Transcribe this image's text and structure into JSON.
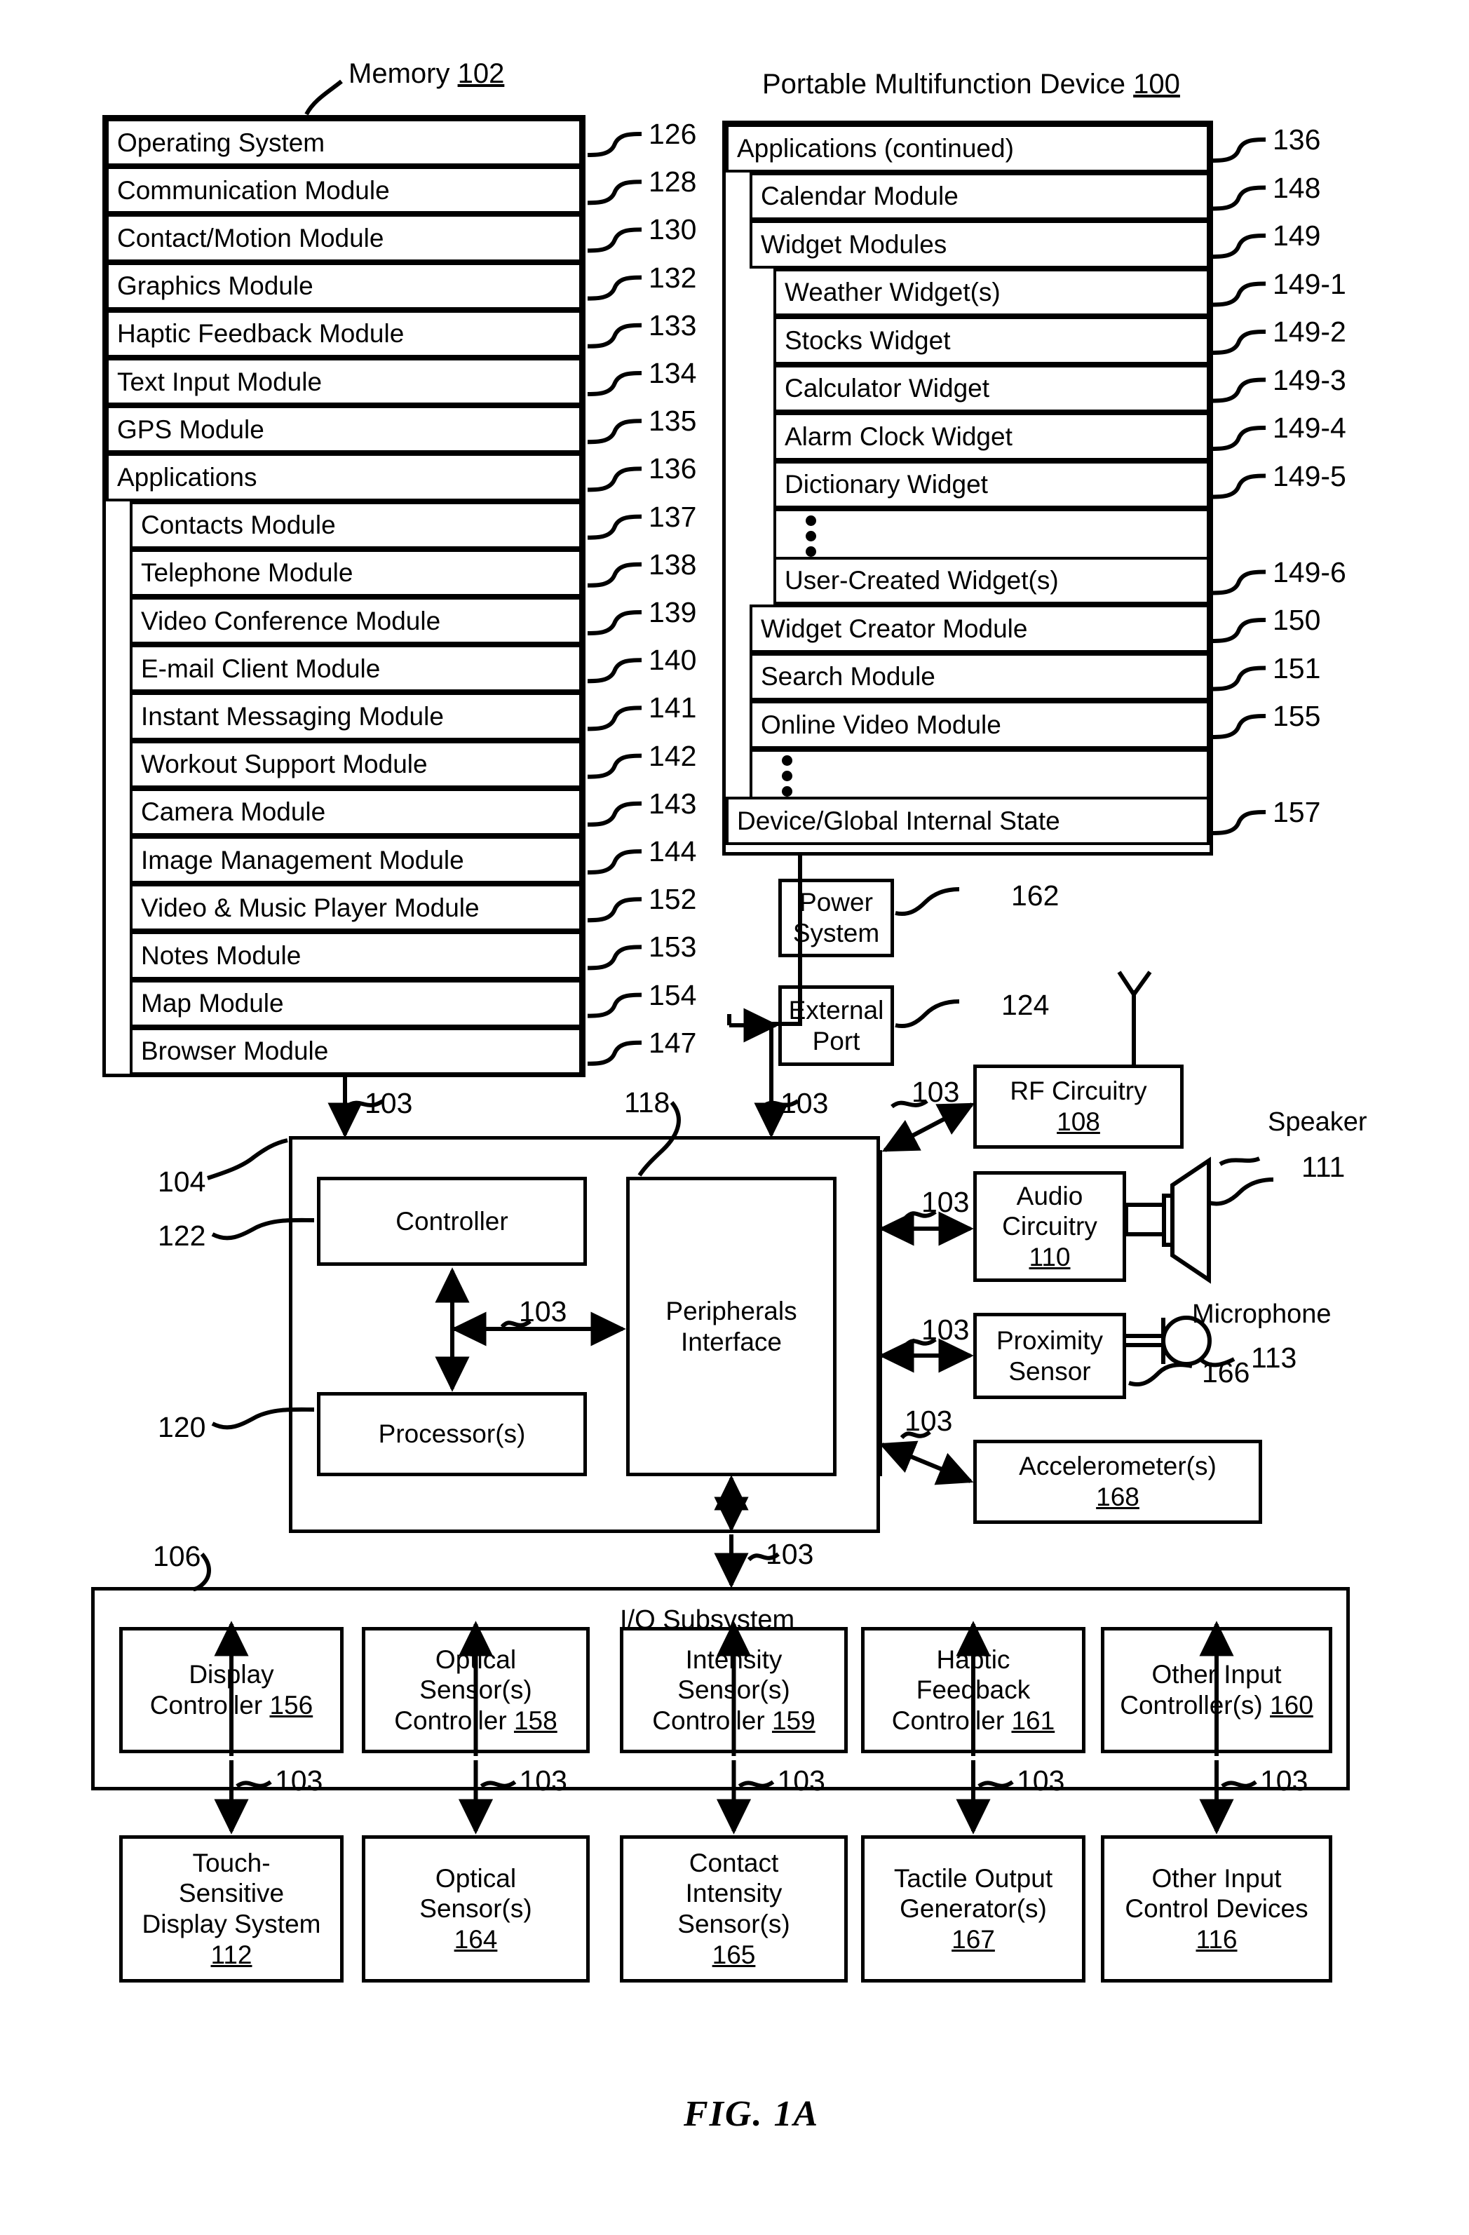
{
  "figure": {
    "caption": "FIG. 1A",
    "memory_title": "Memory",
    "memory_ref": "102",
    "device_title": "Portable Multifunction Device",
    "device_ref": "100"
  },
  "memory_rows": [
    {
      "label": "Operating System",
      "ref": "126",
      "indent": 0
    },
    {
      "label": "Communication Module",
      "ref": "128",
      "indent": 0
    },
    {
      "label": "Contact/Motion Module",
      "ref": "130",
      "indent": 0
    },
    {
      "label": "Graphics Module",
      "ref": "132",
      "indent": 0
    },
    {
      "label": "Haptic Feedback Module",
      "ref": "133",
      "indent": 0
    },
    {
      "label": "Text Input Module",
      "ref": "134",
      "indent": 0
    },
    {
      "label": "GPS Module",
      "ref": "135",
      "indent": 0
    },
    {
      "label": "Applications",
      "ref": "136",
      "indent": 0
    },
    {
      "label": "Contacts Module",
      "ref": "137",
      "indent": 1
    },
    {
      "label": "Telephone Module",
      "ref": "138",
      "indent": 1
    },
    {
      "label": "Video Conference Module",
      "ref": "139",
      "indent": 1
    },
    {
      "label": "E-mail Client Module",
      "ref": "140",
      "indent": 1
    },
    {
      "label": "Instant Messaging Module",
      "ref": "141",
      "indent": 1
    },
    {
      "label": "Workout Support Module",
      "ref": "142",
      "indent": 1
    },
    {
      "label": "Camera Module",
      "ref": "143",
      "indent": 1
    },
    {
      "label": "Image Management Module",
      "ref": "144",
      "indent": 1
    },
    {
      "label": "Video & Music Player Module",
      "ref": "152",
      "indent": 1
    },
    {
      "label": "Notes Module",
      "ref": "153",
      "indent": 1
    },
    {
      "label": "Map Module",
      "ref": "154",
      "indent": 1
    },
    {
      "label": "Browser Module",
      "ref": "147",
      "indent": 1
    }
  ],
  "applications_rows": [
    {
      "label": "Applications (continued)",
      "ref": "136",
      "indent": 0
    },
    {
      "label": "Calendar Module",
      "ref": "148",
      "indent": 1
    },
    {
      "label": "Widget Modules",
      "ref": "149",
      "indent": 1
    },
    {
      "label": "Weather Widget(s)",
      "ref": "149-1",
      "indent": 2
    },
    {
      "label": "Stocks Widget",
      "ref": "149-2",
      "indent": 2
    },
    {
      "label": "Calculator Widget",
      "ref": "149-3",
      "indent": 2
    },
    {
      "label": "Alarm Clock Widget",
      "ref": "149-4",
      "indent": 2
    },
    {
      "label": "Dictionary Widget",
      "ref": "149-5",
      "indent": 2
    },
    {
      "label": "",
      "ref": "",
      "indent": 2,
      "dots": true
    },
    {
      "label": "User-Created Widget(s)",
      "ref": "149-6",
      "indent": 2
    },
    {
      "label": "Widget Creator Module",
      "ref": "150",
      "indent": 1
    },
    {
      "label": "Search Module",
      "ref": "151",
      "indent": 1
    },
    {
      "label": "Online Video Module",
      "ref": "155",
      "indent": 1
    },
    {
      "label": "",
      "ref": "",
      "indent": 1,
      "dots": true
    },
    {
      "label": "Device/Global Internal State",
      "ref": "157",
      "indent": 0
    }
  ],
  "blocks": {
    "power_system": {
      "line1": "Power",
      "line2": "System",
      "ref": "162"
    },
    "external_port": {
      "line1": "External",
      "line2": "Port",
      "ref": "124"
    },
    "rf_circuitry": {
      "line1": "RF Circuitry",
      "num": "108",
      "ref": ""
    },
    "audio_circuitry": {
      "line1": "Audio",
      "line2": "Circuitry",
      "num": "110"
    },
    "proximity_sensor": {
      "line1": "Proximity",
      "line2": "Sensor",
      "ref": "166"
    },
    "accelerometers": {
      "line1": "Accelerometer(s)",
      "num": "168"
    },
    "controller": {
      "label": "Controller",
      "ref": "122"
    },
    "processors": {
      "label": "Processor(s)",
      "ref": "120"
    },
    "peripherals": {
      "line1": "Peripherals",
      "line2": "Interface",
      "ref": "118"
    },
    "cpu_frame_ref": "104",
    "speaker": {
      "label": "Speaker",
      "ref": "111"
    },
    "microphone": {
      "label": "Microphone",
      "ref": "113"
    },
    "io_subsystem": {
      "label": "I/O Subsystem",
      "ref": "106"
    }
  },
  "io_controllers": [
    {
      "lines": [
        "Display",
        "Controller"
      ],
      "num": "156"
    },
    {
      "lines": [
        "Optical",
        "Sensor(s)",
        "Controller"
      ],
      "num": "158"
    },
    {
      "lines": [
        "Intensity",
        "Sensor(s)",
        "Controller"
      ],
      "num": "159"
    },
    {
      "lines": [
        "Haptic",
        "Feedback",
        "Controller"
      ],
      "num": "161"
    },
    {
      "lines": [
        "Other Input",
        "Controller(s)"
      ],
      "num": "160"
    }
  ],
  "io_devices": [
    {
      "lines": [
        "Touch-",
        "Sensitive",
        "Display System"
      ],
      "num": "112"
    },
    {
      "lines": [
        "Optical",
        "Sensor(s)"
      ],
      "num": "164"
    },
    {
      "lines": [
        "Contact",
        "Intensity",
        "Sensor(s)"
      ],
      "num": "165"
    },
    {
      "lines": [
        "Tactile Output",
        "Generator(s)"
      ],
      "num": "167"
    },
    {
      "lines": [
        "Other Input",
        "Control Devices"
      ],
      "num": "116"
    }
  ],
  "bus_labels": {
    "code": "103",
    "count_top_left": "103",
    "count_top_mid": "103"
  },
  "colors": {
    "ink": "#000000",
    "paper": "#ffffff"
  }
}
